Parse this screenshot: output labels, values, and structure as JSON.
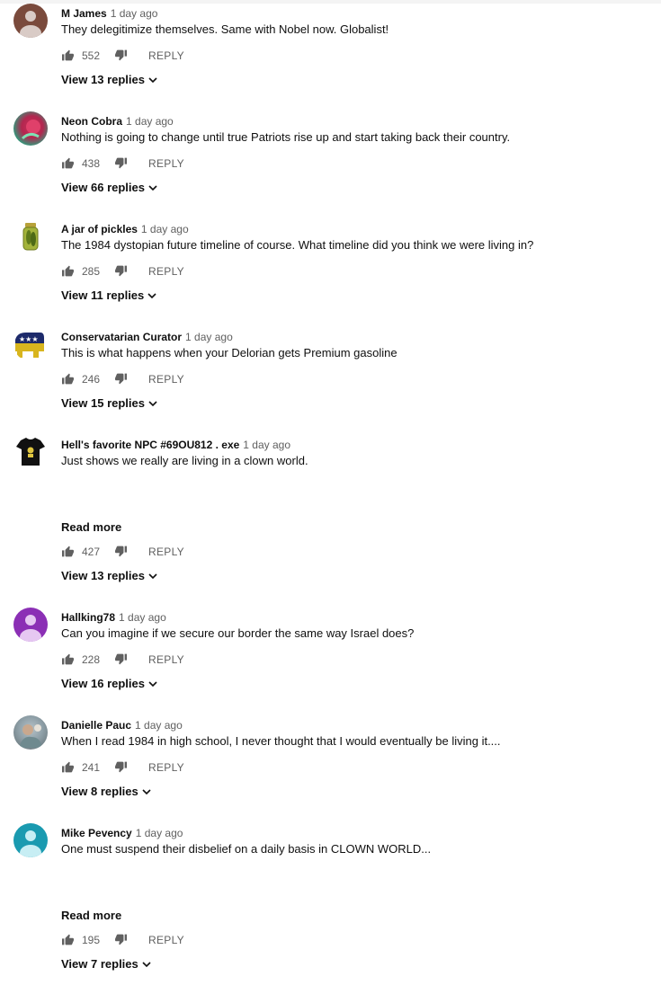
{
  "comments": [
    {
      "name": "M James",
      "time": "1 day ago",
      "text": "They delegitimize themselves. Same with Nobel now. Globalist!",
      "likes": "552",
      "reply": "REPLY",
      "replies": "View 13 replies",
      "avatar": "person-avatar"
    },
    {
      "name": "Neon Cobra",
      "time": "1 day ago",
      "text": "Nothing is going to change until true Patriots rise up and start taking back their country.",
      "likes": "438",
      "reply": "REPLY",
      "replies": "View 66 replies",
      "avatar": "neon-avatar"
    },
    {
      "name": "A jar of pickles",
      "time": "1 day ago",
      "text": "The 1984 dystopian future timeline of course. What timeline did you think we were living in?",
      "likes": "285",
      "reply": "REPLY",
      "replies": "View 11 replies",
      "avatar": "pickle-jar-avatar"
    },
    {
      "name": "Conservatarian Curator",
      "time": "1 day ago",
      "text": "This is what happens when your Delorian gets Premium gasoline",
      "likes": "246",
      "reply": "REPLY",
      "replies": "View 15 replies",
      "avatar": "elephant-avatar"
    },
    {
      "name": "Hell's favorite NPC #69OU812 . exe",
      "time": "1 day ago",
      "text": "Just shows we really are living in a clown world.",
      "readmore": "Read more",
      "likes": "427",
      "reply": "REPLY",
      "replies": "View 13 replies",
      "avatar": "tshirt-avatar"
    },
    {
      "name": "Hallking78",
      "time": "1 day ago",
      "text": "Can you imagine if we secure our border the same way Israel does?",
      "likes": "228",
      "reply": "REPLY",
      "replies": "View 16 replies",
      "avatar": "person-avatar"
    },
    {
      "name": "Danielle Pauc",
      "time": "1 day ago",
      "text": "When I read 1984 in high school, I never thought that I would eventually be living it....",
      "likes": "241",
      "reply": "REPLY",
      "replies": "View 8 replies",
      "avatar": "photo-avatar"
    },
    {
      "name": "Mike Pevency",
      "time": "1 day ago",
      "text": "One must suspend their disbelief on a daily basis in CLOWN WORLD...",
      "readmore": "Read more",
      "likes": "195",
      "reply": "REPLY",
      "replies": "View 7 replies",
      "avatar": "person-avatar"
    }
  ]
}
